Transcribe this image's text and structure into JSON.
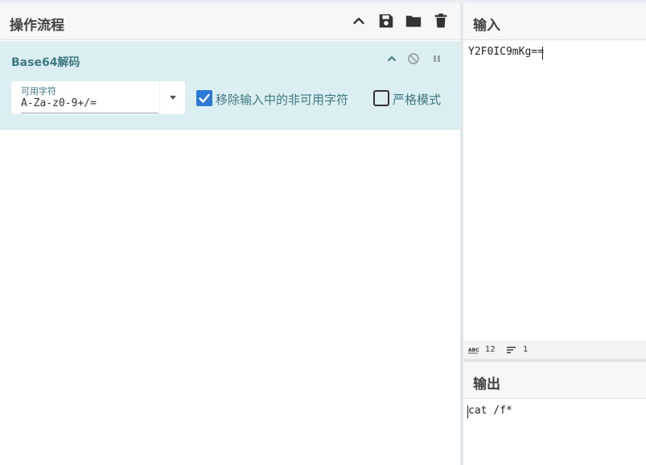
{
  "recipe": {
    "title": "操作流程",
    "operation": {
      "title": "Base64解码",
      "alphabet_label": "可用字符",
      "alphabet_value": "A-Za-z0-9+/=",
      "remove_nonalpha_label": "移除输入中的非可用字符",
      "remove_nonalpha_checked": true,
      "strict_mode_label": "严格模式",
      "strict_mode_checked": false
    }
  },
  "input": {
    "title": "输入",
    "value": "Y2F0IC9mKg==",
    "stats": {
      "length": "12",
      "lines": "1"
    }
  },
  "output": {
    "title": "输出",
    "value": "cat /f*"
  },
  "colors": {
    "accent": "#3f7a84",
    "operation_bg": "#dbeef1",
    "checkbox_blue": "#2a7ad5"
  },
  "icons": {
    "collapse": "chevron-up-icon",
    "save": "save-icon",
    "load": "folder-icon",
    "clear": "trash-icon",
    "disable": "disable-icon",
    "breakpoint": "pause-icon",
    "dropdown": "caret-down-icon",
    "length": "abc-icon",
    "lines": "lines-icon"
  }
}
